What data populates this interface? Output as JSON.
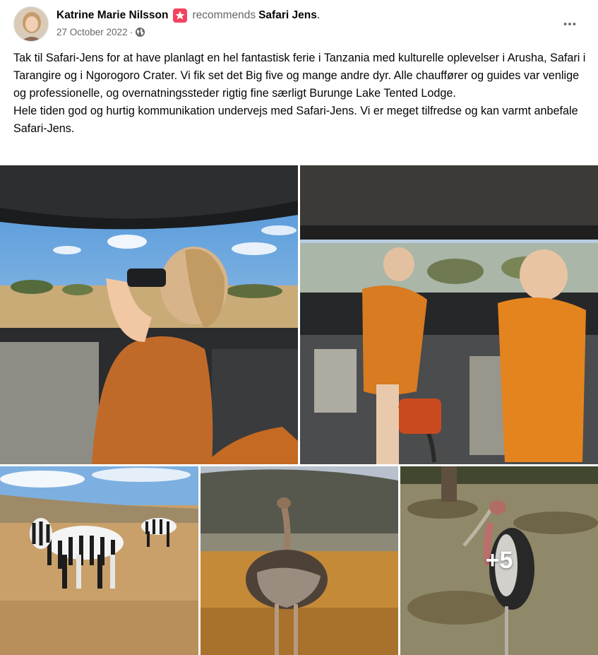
{
  "post": {
    "author": "Katrine Marie Nilsson",
    "action": "recommends",
    "page": "Safari Jens",
    "page_suffix": ".",
    "date": "27 October 2022",
    "date_separator": "·",
    "privacy_icon": "globe-icon",
    "more_icon": "more-dots-icon",
    "paragraphs": [
      "Tak til Safari-Jens for at have planlagt en hel fantastisk ferie i Tanzania med kulturelle oplevelser i Arusha, Safari i Tarangire og i Ngorogoro Crater. Vi fik set det Big five og mange andre dyr. Alle chauffører og guides var venlige og professionelle, og overnatningssteder rigtig fine særligt Burunge Lake Tented Lodge.",
      "Hele tiden god og hurtig kommunikation undervejs med Safari-Jens. Vi er meget tilfredse og kan varmt anbefale Safari-Jens."
    ]
  },
  "photos": {
    "more_count": "+5"
  },
  "colors": {
    "text": "#050505",
    "secondary": "#65676b",
    "badge": "#f3425f"
  }
}
